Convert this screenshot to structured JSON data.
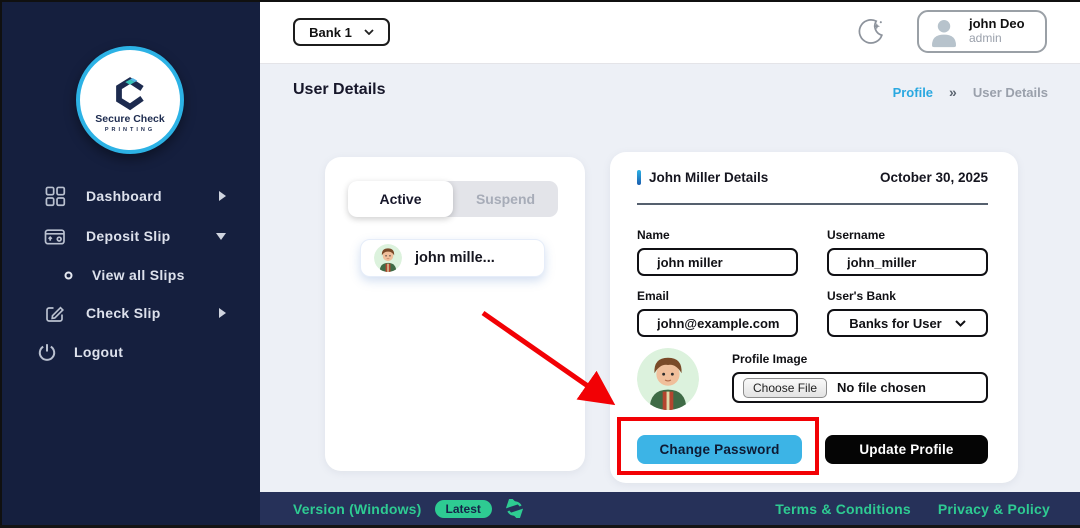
{
  "colors": {
    "sidebar_navy": "#151f3e",
    "footer_navy": "#263159",
    "content_bg": "#edf0f6",
    "accent_cyan": "#2cb2e5",
    "change_password_cyan": "#3cb4e6",
    "update_profile_black": "#050505",
    "success_green": "#2ecb92",
    "annotation_red": "#f20105"
  },
  "icons": {
    "theme_toggle": "moon-icon",
    "bank_dropdown": "chevron-down-icon",
    "user_placeholder": "person-silhouette-icon",
    "dashboard": "grid-icon",
    "deposit_slip": "wallet-icon",
    "view_all_slips": "dot-circle-icon",
    "check_slip": "note-pencil-icon",
    "logout": "power-icon",
    "refresh": "refresh-arrows-icon",
    "annotation": "red-arrow"
  },
  "topbar": {
    "bank_select_value": "Bank 1",
    "user_name": "john Deo",
    "user_role": "admin"
  },
  "sidebar": {
    "logo_line1": "Secure Check",
    "logo_line2": "PRINTING",
    "items": [
      {
        "label": "Dashboard"
      },
      {
        "label": "Deposit Slip"
      },
      {
        "label": "View all Slips"
      },
      {
        "label": "Check Slip"
      },
      {
        "label": "Logout"
      }
    ]
  },
  "page": {
    "title": "User Details",
    "breadcrumb_parent": "Profile",
    "breadcrumb_separator": "»",
    "breadcrumb_current": "User Details"
  },
  "user_list": {
    "tab_active": "Active",
    "tab_suspend": "Suspend",
    "items": [
      {
        "name": "john mille..."
      }
    ]
  },
  "details": {
    "title": "John Miller Details",
    "date": "October 30, 2025",
    "name_label": "Name",
    "name_value": "john miller",
    "username_label": "Username",
    "username_value": "john_miller",
    "email_label": "Email",
    "email_value": "john@example.com",
    "bank_label": "User's Bank",
    "bank_value": "Banks for User",
    "profile_image_label": "Profile Image",
    "choose_file_label": "Choose File",
    "no_file_text": "No file chosen",
    "change_password_label": "Change Password",
    "update_profile_label": "Update Profile"
  },
  "footer": {
    "version_text": "Version (Windows)",
    "badge": "Latest",
    "links": [
      {
        "label": "Terms & Conditions"
      },
      {
        "label": "Privacy & Policy"
      }
    ]
  }
}
